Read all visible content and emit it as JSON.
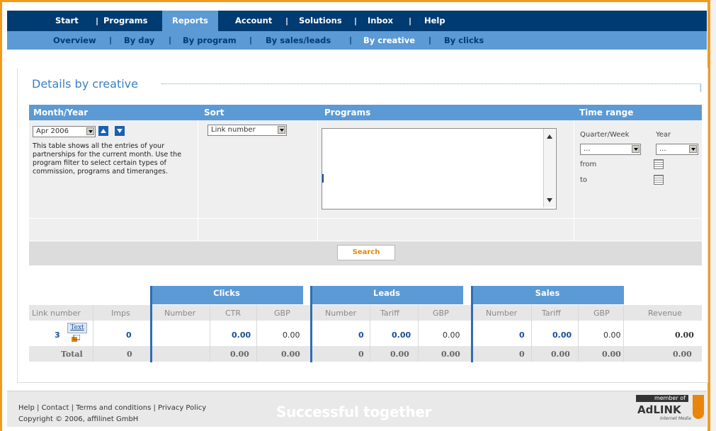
{
  "topnav": {
    "items": [
      "Start",
      "Programs",
      "Reports",
      "Account",
      "Solutions",
      "Inbox",
      "Help"
    ],
    "active": "Reports",
    "sep": "|"
  },
  "subnav": {
    "items": [
      "Overview",
      "By day",
      "By program",
      "By sales/leads",
      "By creative",
      "By clicks"
    ],
    "active": "By creative",
    "sep": "|"
  },
  "page": {
    "title": "Details by creative"
  },
  "filters": {
    "month_year_label": "Month/Year",
    "month_value": "Apr 2006",
    "sort_label": "Sort",
    "sort_value": "Link number",
    "programs_label": "Programs",
    "time_range_label": "Time range",
    "description": "This table shows all the entries of your partnerships for the current month. Use the program filter to select certain types of commission, programs and timeranges.",
    "quarter_week_label": "Quarter/Week",
    "quarter_value": "...",
    "year_label": "Year",
    "year_value": "...",
    "from_label": "from",
    "to_label": "to",
    "search_button": "Search"
  },
  "table": {
    "groups": [
      "Clicks",
      "Leads",
      "Sales"
    ],
    "columns": [
      "Link number",
      "Imps",
      "Number",
      "CTR",
      "GBP",
      "Number",
      "Tariff",
      "GBP",
      "Number",
      "Tariff",
      "GBP",
      "Revenue"
    ],
    "row": {
      "link_number": "3",
      "text_badge": "Text",
      "imps": "0",
      "clicks_number": "",
      "ctr": "0.00",
      "clicks_gbp": "0.00",
      "leads_number": "0",
      "leads_tariff": "0.00",
      "leads_gbp": "0.00",
      "sales_number": "0",
      "sales_tariff": "0.00",
      "sales_gbp": "0.00",
      "revenue": "0.00"
    },
    "total": {
      "label": "Total",
      "imps": "0",
      "ctr": "0.00",
      "clicks_gbp": "0.00",
      "leads_number": "0",
      "leads_tariff": "0.00",
      "leads_gbp": "0.00",
      "sales_number": "0",
      "sales_tariff": "0.00",
      "sales_gbp": "0.00",
      "revenue": "0.00"
    }
  },
  "footer": {
    "links": [
      "Help",
      "Contact",
      "Terms and conditions",
      "Privacy Policy"
    ],
    "sep": "|",
    "copyright": "Copyright © 2006, affilinet GmbH",
    "tagline": "Successful together",
    "logo_top": "member of",
    "logo_text": "AdLINK",
    "logo_sub": "Internet Media"
  },
  "colors": {
    "accent": "#f39a1e",
    "nav": "#003b72",
    "subnav": "#5b9ad5",
    "link_blue": "#1a4f96"
  }
}
